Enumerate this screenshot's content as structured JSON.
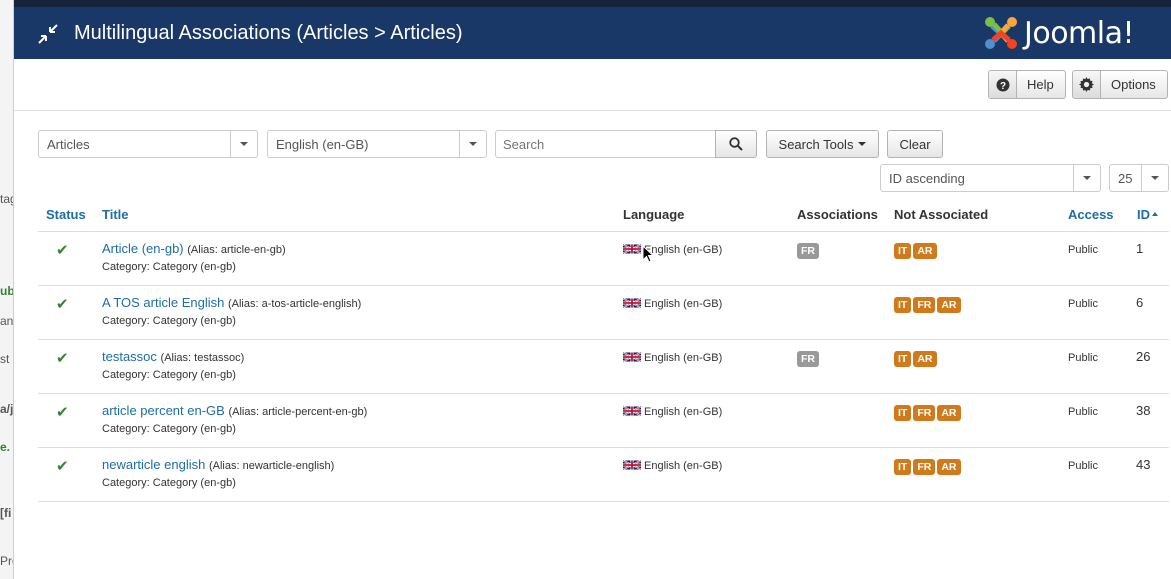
{
  "background_window": {
    "fragments": [
      "tag",
      "ub",
      "an",
      "st",
      "a/j",
      "e.",
      "[fi",
      "Pre"
    ]
  },
  "header": {
    "title": "Multilingual Associations (Articles > Articles)",
    "logo_text": "Joomla!",
    "collapse_icon": "collapse-arrows-icon"
  },
  "toolbar": {
    "help_label": "Help",
    "options_label": "Options"
  },
  "filters": {
    "item_type": "Articles",
    "language": "English (en-GB)",
    "search_placeholder": "Search",
    "search_tools_label": "Search Tools",
    "clear_label": "Clear",
    "ordering": "ID ascending",
    "limit": "25"
  },
  "table": {
    "headers": {
      "status": "Status",
      "title": "Title",
      "language": "Language",
      "associations": "Associations",
      "not_associated": "Not Associated",
      "access": "Access",
      "id": "ID"
    },
    "rows": [
      {
        "title": "Article (en-gb)",
        "alias": "(Alias: article-en-gb)",
        "category": "Category: Category (en-gb)",
        "language": "English (en-GB)",
        "associations": [
          "FR"
        ],
        "not_associated": [
          "IT",
          "AR"
        ],
        "access": "Public",
        "id": "1"
      },
      {
        "title": "A TOS article English",
        "alias": "(Alias: a-tos-article-english)",
        "category": "Category: Category (en-gb)",
        "language": "English (en-GB)",
        "associations": [],
        "not_associated": [
          "IT",
          "FR",
          "AR"
        ],
        "access": "Public",
        "id": "6"
      },
      {
        "title": "testassoc",
        "alias": "(Alias: testassoc)",
        "category": "Category: Category (en-gb)",
        "language": "English (en-GB)",
        "associations": [
          "FR"
        ],
        "not_associated": [
          "IT",
          "AR"
        ],
        "access": "Public",
        "id": "26"
      },
      {
        "title": "article percent en-GB",
        "alias": "(Alias: article-percent-en-gb)",
        "category": "Category: Category (en-gb)",
        "language": "English (en-GB)",
        "associations": [],
        "not_associated": [
          "IT",
          "FR",
          "AR"
        ],
        "access": "Public",
        "id": "38"
      },
      {
        "title": "newarticle english",
        "alias": "(Alias: newarticle-english)",
        "category": "Category: Category (en-gb)",
        "language": "English (en-GB)",
        "associations": [],
        "not_associated": [
          "IT",
          "FR",
          "AR"
        ],
        "access": "Public",
        "id": "43"
      }
    ]
  },
  "colors": {
    "header_bg": "#1a3867",
    "link": "#1f6ca6",
    "published_check": "#378137",
    "badge_associated": "#999999",
    "badge_not_associated": "#d07a1c"
  }
}
